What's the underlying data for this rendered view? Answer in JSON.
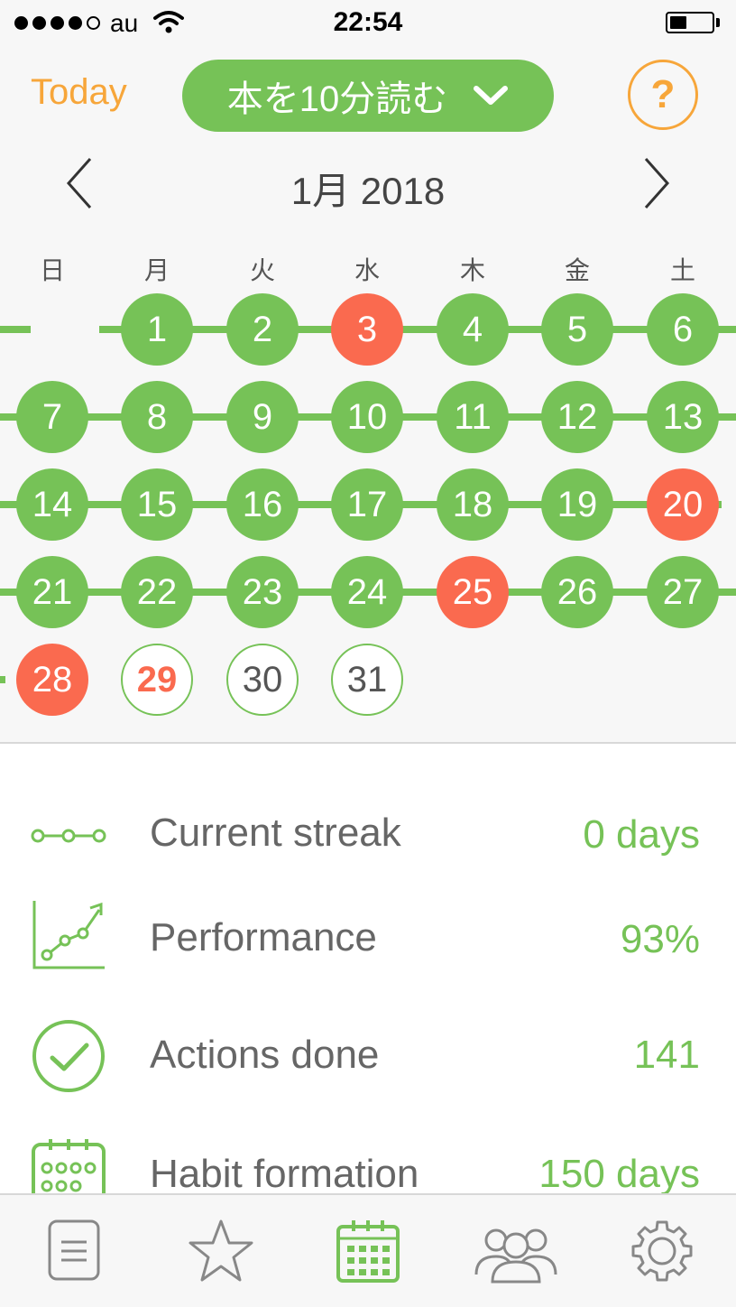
{
  "status_bar": {
    "carrier": "au",
    "time": "22:54"
  },
  "header": {
    "today_label": "Today",
    "habit_name": "本を10分読む",
    "help_label": "?"
  },
  "calendar": {
    "month_label": "1月 2018",
    "weekdays": [
      "日",
      "月",
      "火",
      "水",
      "木",
      "金",
      "土"
    ],
    "days": [
      {
        "label": "1",
        "status": "done"
      },
      {
        "label": "2",
        "status": "done"
      },
      {
        "label": "3",
        "status": "missed"
      },
      {
        "label": "4",
        "status": "done"
      },
      {
        "label": "5",
        "status": "done"
      },
      {
        "label": "6",
        "status": "done"
      },
      {
        "label": "7",
        "status": "done"
      },
      {
        "label": "8",
        "status": "done"
      },
      {
        "label": "9",
        "status": "done"
      },
      {
        "label": "10",
        "status": "done"
      },
      {
        "label": "11",
        "status": "done"
      },
      {
        "label": "12",
        "status": "done"
      },
      {
        "label": "13",
        "status": "done"
      },
      {
        "label": "14",
        "status": "done"
      },
      {
        "label": "15",
        "status": "done"
      },
      {
        "label": "16",
        "status": "done"
      },
      {
        "label": "17",
        "status": "done"
      },
      {
        "label": "18",
        "status": "done"
      },
      {
        "label": "19",
        "status": "done"
      },
      {
        "label": "20",
        "status": "missed"
      },
      {
        "label": "21",
        "status": "done"
      },
      {
        "label": "22",
        "status": "done"
      },
      {
        "label": "23",
        "status": "done"
      },
      {
        "label": "24",
        "status": "done"
      },
      {
        "label": "25",
        "status": "missed"
      },
      {
        "label": "26",
        "status": "done"
      },
      {
        "label": "27",
        "status": "done"
      },
      {
        "label": "28",
        "status": "missed"
      },
      {
        "label": "29",
        "status": "today"
      },
      {
        "label": "30",
        "status": "future"
      },
      {
        "label": "31",
        "status": "future"
      }
    ]
  },
  "stats": [
    {
      "icon": "streak-icon",
      "label": "Current streak",
      "value": "0 days"
    },
    {
      "icon": "performance-chart-icon",
      "label": "Performance",
      "value": "93%"
    },
    {
      "icon": "check-circle-icon",
      "label": "Actions done",
      "value": "141"
    },
    {
      "icon": "calendar-grid-icon",
      "label": "Habit formation",
      "value": "150 days"
    }
  ],
  "tabs": [
    {
      "icon": "list-icon",
      "active": false
    },
    {
      "icon": "star-icon",
      "active": false
    },
    {
      "icon": "calendar-icon",
      "active": true
    },
    {
      "icon": "group-icon",
      "active": false
    },
    {
      "icon": "gear-icon",
      "active": false
    }
  ],
  "colors": {
    "accent_green": "#76c257",
    "missed_red": "#fa6a4f",
    "today_orange": "#f7a63a"
  }
}
